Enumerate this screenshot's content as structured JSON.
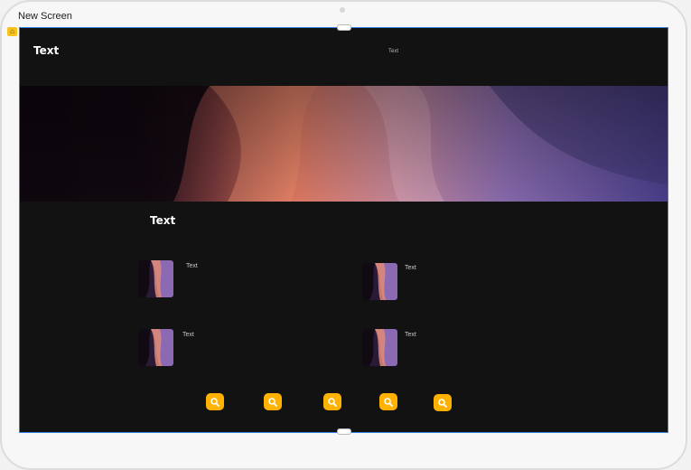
{
  "window": {
    "title": "New Screen"
  },
  "header": {
    "title": "Text",
    "subtitle": "Text"
  },
  "section": {
    "title": "Text"
  },
  "cards": [
    {
      "label": "Text"
    },
    {
      "label": "Text"
    },
    {
      "label": "Text"
    },
    {
      "label": "Text"
    }
  ],
  "actions": [
    {
      "icon": "search-icon"
    },
    {
      "icon": "search-icon"
    },
    {
      "icon": "search-icon"
    },
    {
      "icon": "search-icon"
    },
    {
      "icon": "search-icon"
    }
  ],
  "colors": {
    "background": "#121212",
    "accent": "#ffb300",
    "selection": "#2f7de1"
  }
}
